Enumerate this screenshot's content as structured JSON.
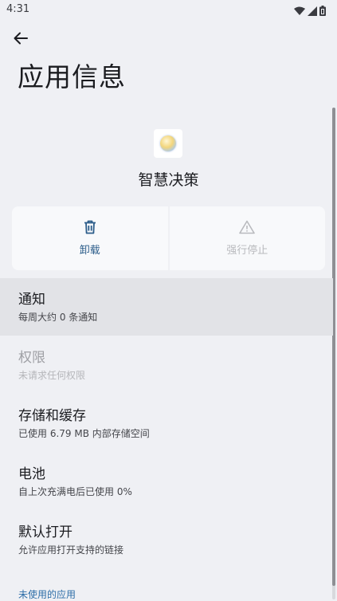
{
  "status_bar": {
    "time": "4:31",
    "icons": [
      "wifi-icon",
      "signal-icon",
      "battery-icon"
    ]
  },
  "header": {
    "back_icon": "arrow-left-icon",
    "title": "应用信息"
  },
  "app": {
    "name": "智慧决策"
  },
  "actions": {
    "uninstall_label": "卸载",
    "uninstall_icon": "trash-icon",
    "force_stop_label": "强行停止",
    "force_stop_icon": "warning-icon",
    "force_stop_enabled": false
  },
  "items": [
    {
      "title": "通知",
      "subtitle": "每周大约 0 条通知",
      "enabled": true
    },
    {
      "title": "权限",
      "subtitle": "未请求任何权限",
      "enabled": false
    },
    {
      "title": "存储和缓存",
      "subtitle": "已使用 6.79 MB 内部存储空间",
      "enabled": true
    },
    {
      "title": "电池",
      "subtitle": "自上次充满电后已使用 0%",
      "enabled": true
    },
    {
      "title": "默认打开",
      "subtitle": "允许应用打开支持的链接",
      "enabled": true
    }
  ],
  "section_unused": {
    "label": "未使用的应用"
  },
  "colors": {
    "background": "#eff0f4",
    "accent": "#2c5d8a",
    "section_header": "#2e6ea8"
  }
}
